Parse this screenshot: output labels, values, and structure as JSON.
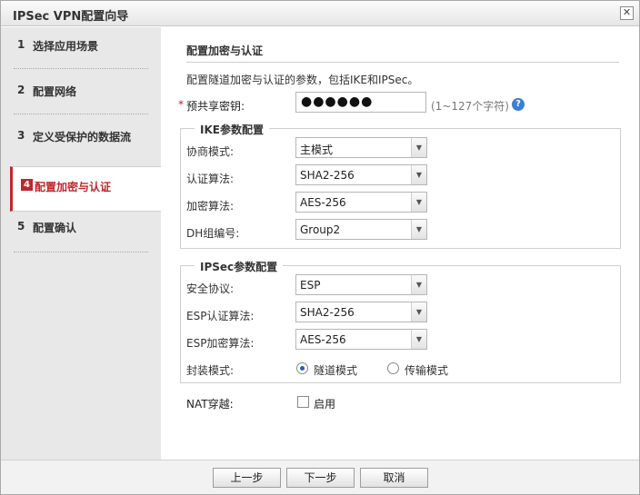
{
  "window": {
    "title": "IPSec VPN配置向导",
    "close_glyph": "✕"
  },
  "steps": [
    {
      "num": "1",
      "label": "选择应用场景"
    },
    {
      "num": "2",
      "label": "配置网络"
    },
    {
      "num": "3",
      "label": "定义受保护的数据流"
    },
    {
      "num": "4",
      "label": "配置加密与认证"
    },
    {
      "num": "5",
      "label": "配置确认"
    }
  ],
  "active_step": 4,
  "main": {
    "title": "配置加密与认证",
    "description": "配置隧道加密与认证的参数，包括IKE和IPSec。",
    "psk": {
      "required_mark": "*",
      "label": "预共享密钥:",
      "value": "●●●●●●",
      "hint": "(1~127个字符)",
      "help_glyph": "?"
    },
    "ike": {
      "legend": "IKE参数配置",
      "rows": [
        {
          "label": "协商模式:",
          "value": "主模式"
        },
        {
          "label": "认证算法:",
          "value": "SHA2-256"
        },
        {
          "label": "加密算法:",
          "value": "AES-256"
        },
        {
          "label": "DH组编号:",
          "value": "Group2"
        }
      ]
    },
    "ipsec": {
      "legend": "IPSec参数配置",
      "rows": [
        {
          "label": "安全协议:",
          "value": "ESP"
        },
        {
          "label": "ESP认证算法:",
          "value": "SHA2-256"
        },
        {
          "label": "ESP加密算法:",
          "value": "AES-256"
        }
      ],
      "encap": {
        "label": "封装模式:",
        "options": [
          "隧道模式",
          "传输模式"
        ],
        "selected": "隧道模式"
      }
    },
    "nat": {
      "label": "NAT穿越:",
      "checkbox_label": "启用",
      "checked": false
    }
  },
  "footer": {
    "prev": "上一步",
    "next": "下一步",
    "cancel": "取消"
  },
  "colors": {
    "accent": "#c0272d",
    "sidebar_bg": "#e8e8e8",
    "help": "#3c7fd1"
  },
  "icons": {
    "select_arrow": "chevron-down-icon",
    "help": "help-icon",
    "close": "close-icon"
  }
}
